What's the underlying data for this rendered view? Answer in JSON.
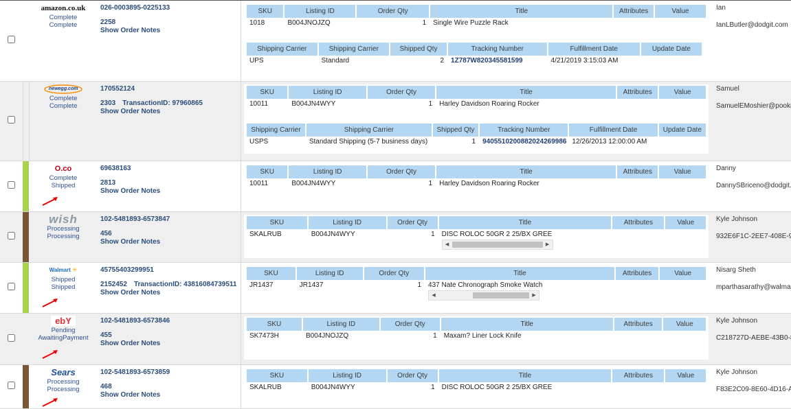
{
  "item_headers": [
    "SKU",
    "Listing ID",
    "Order Qty",
    "Title",
    "Attributes",
    "Value"
  ],
  "ship_headers": [
    "Shipping Carrier",
    "Shipping Carrier",
    "Shipped Qty",
    "Tracking Number",
    "Fulfillment Date",
    "Update Date"
  ],
  "ship_headers_alt": [
    "Shipping Carrier",
    "Shipping Carrier",
    "Shipped Qty",
    "Tracking Number",
    "Fulfillment Date",
    "Update Date"
  ],
  "notes_label": "Show Order Notes",
  "colors": {
    "header_bg": "#b3d7f2",
    "link": "#2a4c7a",
    "flag_green": "#a8d34e",
    "flag_brown": "#7a5634"
  },
  "orders": [
    {
      "channel": "amazon.co.uk",
      "logo_text": "amazon.co.uk",
      "status1": "Complete",
      "status2": "Complete",
      "order_id": "026-0003895-0225133",
      "sub_id": "2258",
      "transaction": "",
      "items": [
        {
          "sku": "1018",
          "listing": "B004JNOJZQ",
          "qty": "1",
          "title": "Single Wire Puzzle Rack",
          "attr": "",
          "value": ""
        }
      ],
      "ship": [
        {
          "carrier": "UPS",
          "service": "Standard",
          "qty": "2",
          "tracking": "1Z787W820345581599",
          "fulfilled": "4/21/2019 3:15:03 AM",
          "updated": ""
        }
      ],
      "customer": "Ian",
      "email": "IanLButler@dodgit.com"
    },
    {
      "channel": "newegg",
      "logo_text": "newegg.com",
      "status1": "Complete",
      "status2": "Complete",
      "order_id": "170552124",
      "sub_id": "2303",
      "transaction": "TransactionID: 97960865",
      "items": [
        {
          "sku": "10011",
          "listing": "B004JN4WYY",
          "qty": "1",
          "title": "Harley Davidson Roaring Rocker",
          "attr": "",
          "value": ""
        }
      ],
      "ship": [
        {
          "carrier": "USPS",
          "service": "Standard Shipping (5-7 business days)",
          "qty": "1",
          "tracking": "9405510200882024269986",
          "fulfilled": "12/26/2013 12:00:00 AM",
          "updated": ""
        }
      ],
      "customer": "Samuel",
      "email": "SamuelEMoshier@pookmail.com"
    },
    {
      "channel": "overstock",
      "logo_text": "O.co",
      "status1": "Complete",
      "status2": "Shipped",
      "order_id": "69638163",
      "sub_id": "2813",
      "transaction": "",
      "items": [
        {
          "sku": "10011",
          "listing": "B004JN4WYY",
          "qty": "1",
          "title": "Harley Davidson Roaring Rocker",
          "attr": "",
          "value": ""
        }
      ],
      "ship": [],
      "customer": "Danny",
      "email": "DannySBriceno@dodgit.com"
    },
    {
      "channel": "wish",
      "logo_text": "wish",
      "status1": "Processing",
      "status2": "Processing",
      "order_id": "102-5481893-6573847",
      "sub_id": "456",
      "transaction": "",
      "items": [
        {
          "sku": "SKALRUB",
          "listing": "B004JN4WYY",
          "qty": "1",
          "title": "DISC ROLOC 50GR 2 25/BX GREEN",
          "attr": "",
          "value": ""
        }
      ],
      "ship": [],
      "customer": "Kyle Johnson",
      "email": "932E6F1C-2EE7-408E-9"
    },
    {
      "channel": "walmart",
      "logo_text": "Walmart",
      "status1": "Shipped",
      "status2": "Shipped",
      "order_id": "45755403299951",
      "sub_id": "2152452",
      "transaction": "TransactionID: 43816084739511",
      "items": [
        {
          "sku": "JR1437",
          "listing": "JR1437",
          "qty": "1",
          "title": "437 Nate Chronograph Smoke Watch",
          "attr": "",
          "value": ""
        }
      ],
      "ship": [],
      "customer": "Nisarg Sheth",
      "email": "mparthasarathy@walmart.com"
    },
    {
      "channel": "ebay",
      "logo_text": "ebY",
      "status1": "Pending",
      "status2": "AwaitingPayment",
      "order_id": "102-5481893-6573846",
      "sub_id": "455",
      "transaction": "",
      "items": [
        {
          "sku": "SK7473H",
          "listing": "B004JNOJZQ",
          "qty": "1",
          "title": "Maxam? Liner Lock Knife",
          "attr": "",
          "value": ""
        }
      ],
      "ship": [],
      "customer": "Kyle Johnson",
      "email": "C218727D-AEBE-43B0-8"
    },
    {
      "channel": "sears",
      "logo_text": "Sears",
      "status1": "Processing",
      "status2": "Processing",
      "order_id": "102-5481893-6573859",
      "sub_id": "468",
      "transaction": "",
      "items": [
        {
          "sku": "SKALRUB",
          "listing": "B004JN4WYY",
          "qty": "1",
          "title": "DISC ROLOC 50GR 2 25/BX GREEN",
          "attr": "",
          "value": ""
        }
      ],
      "ship": [],
      "customer": "Kyle Johnson",
      "email": "F83E2C09-8E60-4D16-A"
    }
  ]
}
